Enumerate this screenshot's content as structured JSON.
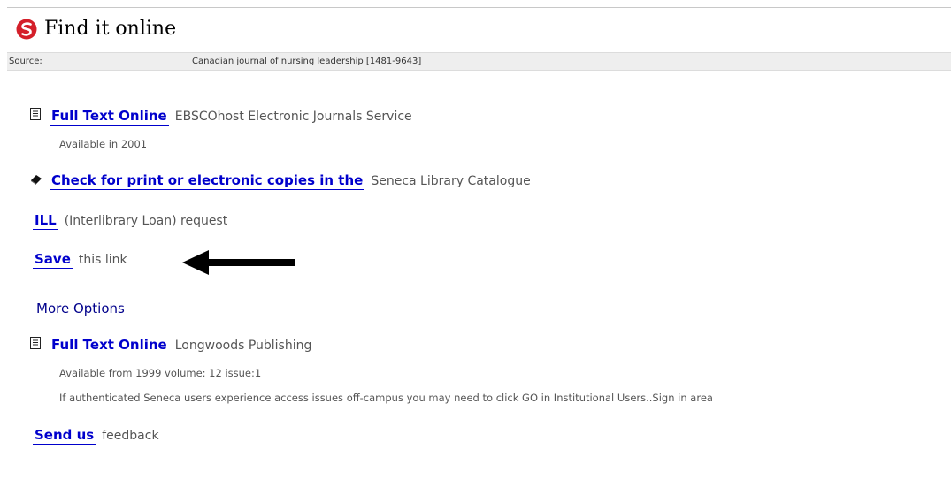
{
  "header": {
    "title": "Find it online",
    "logo_color": "#d41f2a"
  },
  "source": {
    "label": "Source:",
    "value": "Canadian journal of nursing leadership [1481-9643]"
  },
  "options": [
    {
      "icon": "document-icon",
      "link_label": "Full Text Online",
      "description": "EBSCOhost Electronic Journals Service",
      "availability": "Available in 2001"
    },
    {
      "icon": "book-icon",
      "link_label": "Check for print or electronic copies in the",
      "description": "Seneca Library Catalogue"
    },
    {
      "link_label": "ILL",
      "description": "(Interlibrary Loan) request"
    },
    {
      "link_label": "Save",
      "description": "this link"
    }
  ],
  "more_options": {
    "label": "More Options",
    "items": [
      {
        "icon": "document-icon",
        "link_label": "Full Text Online",
        "description": "Longwoods Publishing",
        "availability": "Available from 1999 volume: 12 issue:1",
        "note": "If authenticated Seneca users experience access issues off-campus you may need to click GO in Institutional Users..Sign in area"
      }
    ]
  },
  "feedback": {
    "link_label": "Send us",
    "description": "feedback"
  },
  "annotation": {
    "icon": "left-arrow-icon",
    "color": "#000000"
  },
  "colors": {
    "link": "#0000cc",
    "more_options": "#00008b",
    "source_bar": "#eeeeee"
  }
}
